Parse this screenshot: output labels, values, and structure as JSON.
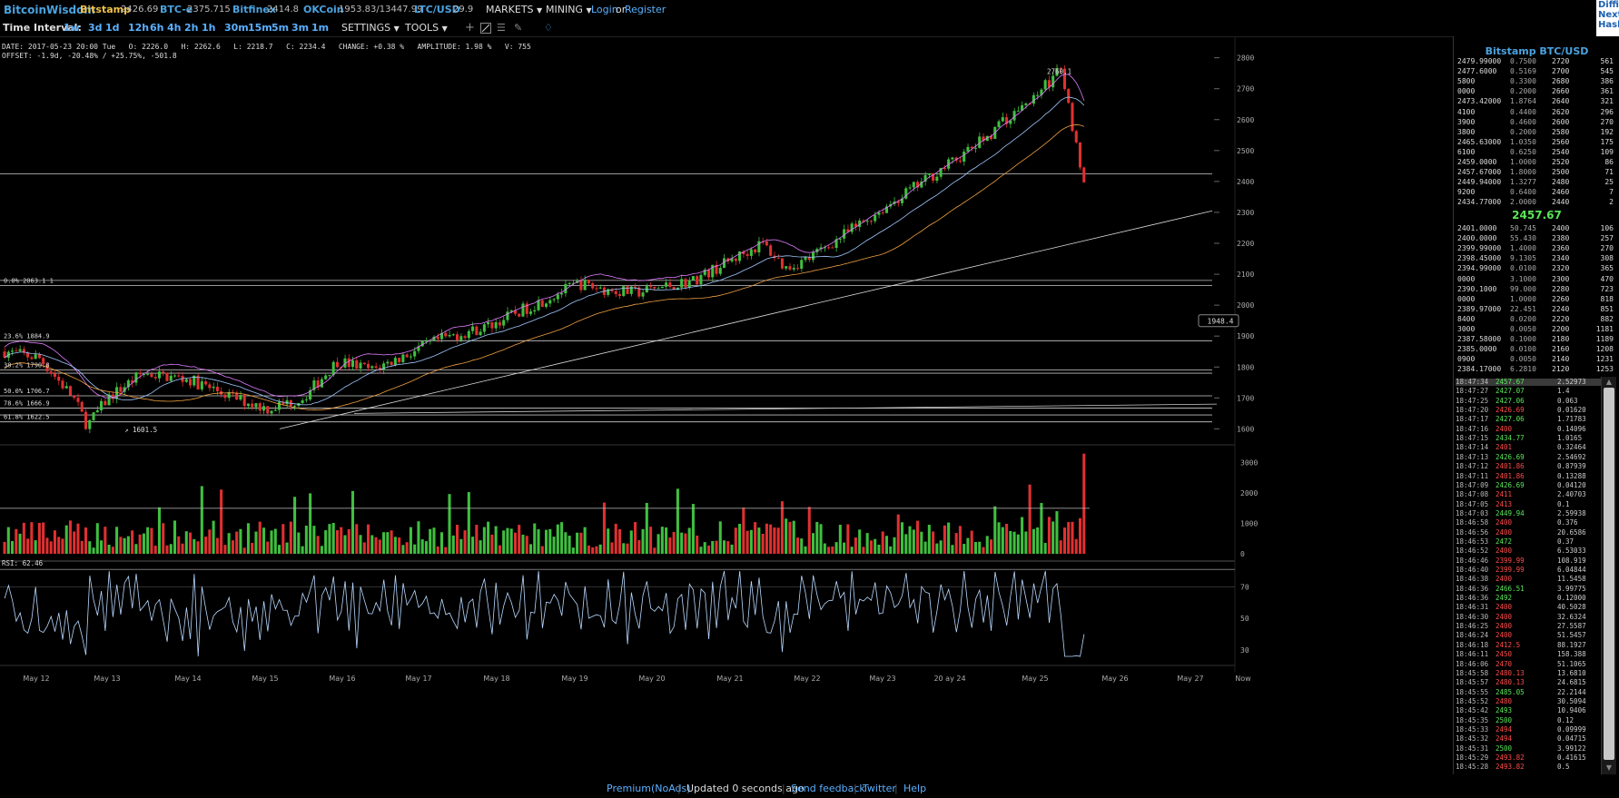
{
  "topbar": {
    "brand": "BitcoinWisdom",
    "exchanges": [
      {
        "name": "Bitstamp",
        "price": "2426.69",
        "style": "gold"
      },
      {
        "name": "BTC-e",
        "price": "2375.715",
        "style": "blue"
      },
      {
        "name": "Bitfinex",
        "price": "2414.8",
        "style": "blue"
      },
      {
        "name": "OKCoin",
        "price": "1953.83/13447.99",
        "style": "blue"
      },
      {
        "name": "LTC/USD",
        "price": "29.9",
        "style": "blue"
      }
    ],
    "markets_label": "MARKETS",
    "mining_label": "MINING",
    "login_label": "Login",
    "or_label": "or",
    "register_label": "Register"
  },
  "side_info": [
    "Diffic",
    "Next:",
    "Hash"
  ],
  "intervals": {
    "label": "Time Interval:",
    "items": [
      "1w",
      "3d",
      "1d",
      "12h",
      "6h",
      "4h",
      "2h",
      "1h",
      "30m",
      "15m",
      "5m",
      "3m",
      "1m"
    ],
    "settings_label": "SETTINGS",
    "tools_label": "TOOLS",
    "tool_icons": [
      "crosshair-icon",
      "line-draw-icon",
      "parallel-lines-icon",
      "pencil-icon",
      "alert-bell-icon"
    ]
  },
  "info": {
    "line1": "DATE: 2017-05-23 20:00 Tue   O: 2226.0   H: 2262.6   L: 2218.7   C: 2234.4   CHANGE: +0.38 %   AMPLITUDE: 1.98 %   V: 755",
    "line2": "OFFSET: -1.9d, -20.48% / +25.75%, -501.8"
  },
  "chart_data": {
    "type": "candlestick",
    "price_axis": {
      "ticks": [
        "2800",
        "2700",
        "2600",
        "2500",
        "2400",
        "2300",
        "2200",
        "2100",
        "2000",
        "1900",
        "1800",
        "1700",
        "1600"
      ],
      "range": [
        1560,
        2840
      ]
    },
    "price_marker": "1948.4",
    "high_label": "2760.1",
    "low_label": "1601.5",
    "fib_labels": [
      "0.0% 2063.1 1",
      "23.6% 1884.9",
      "38.2% 1790.8",
      "50.0% 1706.7",
      "78.6% 1666.9",
      "61.8% 1622.5"
    ],
    "volume_axis": {
      "ticks": [
        "3000",
        "2000",
        "1000",
        "0"
      ],
      "range": [
        0,
        3500
      ]
    },
    "rsi_label": "RSI: 62.46",
    "rsi_axis": {
      "ticks": [
        "70",
        "50",
        "30"
      ],
      "range": [
        22,
        84
      ]
    },
    "x_labels": [
      "May 12",
      "May 13",
      "May 14",
      "May 15",
      "May 16",
      "May 17",
      "May 18",
      "May 19",
      "May 20",
      "May 21",
      "May 22",
      "May 23",
      "20 ay 24",
      "May 25",
      "May 26",
      "May 27",
      "Now"
    ],
    "colors": {
      "up": "#3fbf3f",
      "down": "#e03030",
      "ma1": "#e07cff",
      "ma2": "#9fc8ff",
      "ma3": "#f0a040",
      "rsi": "#b8d8ff"
    }
  },
  "orderbook": {
    "title": "Bitstamp BTC/USD",
    "asks": [
      [
        "2479.99000",
        "0.7500",
        "2720",
        "561"
      ],
      [
        "2477.6000",
        "0.5169",
        "2700",
        "545"
      ],
      [
        "5800",
        "0.3300",
        "2680",
        "386"
      ],
      [
        "0000",
        "0.2000",
        "2660",
        "361"
      ],
      [
        "2473.42000",
        "1.8764",
        "2640",
        "321"
      ],
      [
        "4100",
        "0.4400",
        "2620",
        "296"
      ],
      [
        "3900",
        "0.4600",
        "2600",
        "270"
      ],
      [
        "3800",
        "0.2000",
        "2580",
        "192"
      ],
      [
        "2465.63000",
        "1.0350",
        "2560",
        "175"
      ],
      [
        "6100",
        "0.6250",
        "2540",
        "109"
      ],
      [
        "2459.0000",
        "1.0000",
        "2520",
        "86"
      ],
      [
        "2457.67000",
        "1.8000",
        "2500",
        "71"
      ],
      [
        "2449.94000",
        "1.3277",
        "2480",
        "25"
      ],
      [
        "9200",
        "0.6400",
        "2460",
        "7"
      ],
      [
        "2434.77000",
        "2.0000",
        "2440",
        "2"
      ]
    ],
    "last_price": "2457.67",
    "bids": [
      [
        "2401.0000",
        "50.745",
        "2400",
        "106"
      ],
      [
        "2400.0000",
        "55.430",
        "2380",
        "257"
      ],
      [
        "2399.99000",
        "1.4000",
        "2360",
        "270"
      ],
      [
        "2398.45000",
        "9.1305",
        "2340",
        "308"
      ],
      [
        "2394.99000",
        "0.0100",
        "2320",
        "365"
      ],
      [
        "0000",
        "3.1000",
        "2300",
        "470"
      ],
      [
        "2390.1000",
        "99.000",
        "2280",
        "723"
      ],
      [
        "0000",
        "1.0000",
        "2260",
        "818"
      ],
      [
        "2389.97000",
        "22.451",
        "2240",
        "851"
      ],
      [
        "8400",
        "0.0200",
        "2220",
        "882"
      ],
      [
        "3000",
        "0.0050",
        "2200",
        "1181"
      ],
      [
        "2387.58000",
        "0.1000",
        "2180",
        "1189"
      ],
      [
        "2385.0000",
        "0.0100",
        "2160",
        "1208"
      ],
      [
        "0900",
        "0.0050",
        "2140",
        "1231"
      ],
      [
        "2384.17000",
        "6.2810",
        "2120",
        "1253"
      ]
    ]
  },
  "trades": [
    [
      "18:47:34",
      "2457.67",
      "2.52973",
      "up"
    ],
    [
      "18:47:27",
      "2427.07",
      "1.4",
      "up"
    ],
    [
      "18:47:25",
      "2427.06",
      "0.063",
      "up"
    ],
    [
      "18:47:20",
      "2426.69",
      "0.01620",
      "down"
    ],
    [
      "18:47:17",
      "2427.06",
      "1.71783",
      "up"
    ],
    [
      "18:47:16",
      "2400",
      "0.14096",
      "down"
    ],
    [
      "18:47:15",
      "2434.77",
      "1.0165",
      "up"
    ],
    [
      "18:47:14",
      "2401",
      "0.32464",
      "down"
    ],
    [
      "18:47:13",
      "2426.69",
      "2.54692",
      "up"
    ],
    [
      "18:47:12",
      "2401.86",
      "0.87939",
      "down"
    ],
    [
      "18:47:11",
      "2401.86",
      "0.13288",
      "down"
    ],
    [
      "18:47:09",
      "2426.69",
      "0.04120",
      "up"
    ],
    [
      "18:47:08",
      "2411",
      "2.40703",
      "down"
    ],
    [
      "18:47:05",
      "2413",
      "0.1",
      "down"
    ],
    [
      "18:47:03",
      "2449.94",
      "2.59938",
      "up"
    ],
    [
      "18:46:58",
      "2400",
      "0.376",
      "down"
    ],
    [
      "18:46:56",
      "2400",
      "20.6586",
      "down"
    ],
    [
      "18:46:53",
      "2472",
      "0.37",
      "up"
    ],
    [
      "18:46:52",
      "2400",
      "6.53033",
      "down"
    ],
    [
      "18:46:46",
      "2399.99",
      "108.919",
      "down"
    ],
    [
      "18:46:40",
      "2399.99",
      "6.04844",
      "down"
    ],
    [
      "18:46:38",
      "2400",
      "11.5458",
      "down"
    ],
    [
      "18:46:36",
      "2466.51",
      "3.99775",
      "up"
    ],
    [
      "18:46:36",
      "2492",
      "0.12000",
      "up"
    ],
    [
      "18:46:31",
      "2400",
      "40.5028",
      "down"
    ],
    [
      "18:46:30",
      "2400",
      "32.6324",
      "down"
    ],
    [
      "18:46:25",
      "2400",
      "27.5587",
      "down"
    ],
    [
      "18:46:24",
      "2400",
      "51.5457",
      "down"
    ],
    [
      "18:46:18",
      "2412.5",
      "88.1927",
      "down"
    ],
    [
      "18:46:11",
      "2450",
      "158.388",
      "down"
    ],
    [
      "18:46:06",
      "2470",
      "51.1065",
      "down"
    ],
    [
      "18:45:58",
      "2480.13",
      "13.6810",
      "down"
    ],
    [
      "18:45:57",
      "2480.13",
      "24.6815",
      "down"
    ],
    [
      "18:45:55",
      "2485.05",
      "22.2144",
      "up"
    ],
    [
      "18:45:52",
      "2480",
      "30.5094",
      "down"
    ],
    [
      "18:45:42",
      "2493",
      "10.9406",
      "up"
    ],
    [
      "18:45:35",
      "2500",
      "0.12",
      "up"
    ],
    [
      "18:45:33",
      "2494",
      "0.09999",
      "down"
    ],
    [
      "18:45:32",
      "2494",
      "0.04715",
      "down"
    ],
    [
      "18:45:31",
      "2500",
      "3.99122",
      "up"
    ],
    [
      "18:45:29",
      "2493.82",
      "0.41615",
      "down"
    ],
    [
      "18:45:28",
      "2493.82",
      "0.5",
      "down"
    ]
  ],
  "footer": {
    "premium": "Premium(NoAds)",
    "updated": "Updated 0 seconds ago",
    "feedback": "Send feedback",
    "twitter": "Twitter",
    "help": "Help"
  }
}
